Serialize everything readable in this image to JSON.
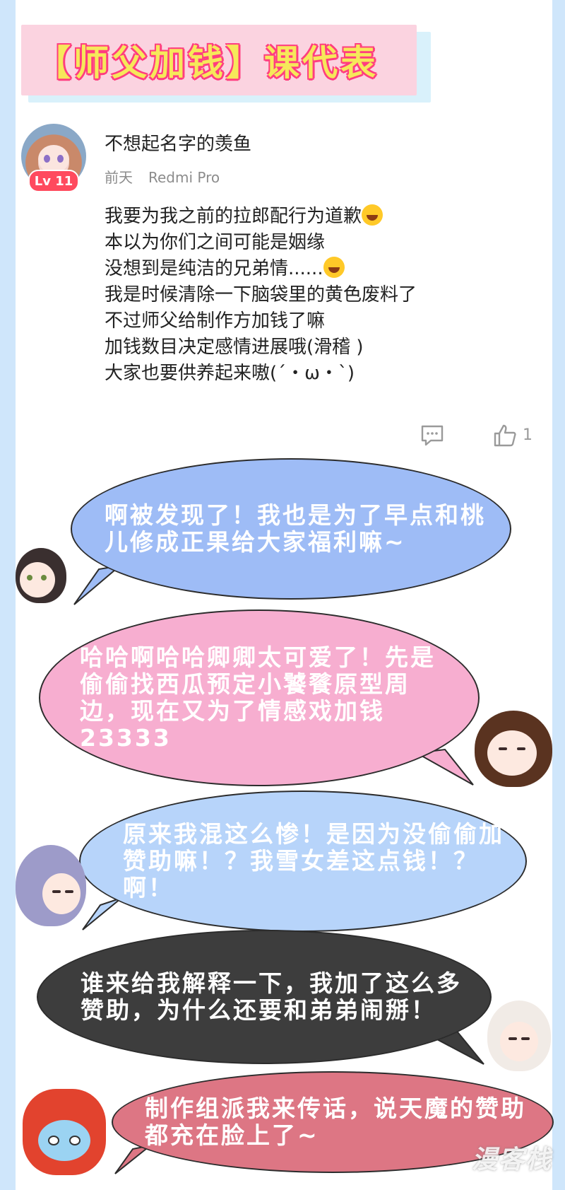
{
  "banner": {
    "title": "【师父加钱】课代表"
  },
  "comment": {
    "username": "不想起名字的羡鱼",
    "level_badge": "Lv 11",
    "time": "前天",
    "device": "Redmi Pro",
    "lines": [
      "我要为我之前的拉郎配行为道歉",
      "本以为你们之间可能是姻缘",
      "没想到是纯洁的兄弟情......",
      "我是时候清除一下脑袋里的黄色废料了",
      "不过师父给制作方加钱了嘛",
      "加钱数目决定感情进展哦(滑稽 )",
      "大家也要供养起来嗷(´・ω・`)"
    ],
    "like_count": "1"
  },
  "bubbles": [
    {
      "text": "啊被发现了！我也是为了早点和桃儿修成正果给大家福利嘛~",
      "color": "#9ebcf6"
    },
    {
      "text": "哈哈啊哈哈卿卿太可爱了！先是偷偷找西瓜预定小饕餮原型周边，现在又为了情感戏加钱23333",
      "color": "#f7aed0"
    },
    {
      "text": "原来我混这么惨！是因为没偷偷加赞助嘛！？我雪女差这点钱！？啊！",
      "color": "#b7d4fa"
    },
    {
      "text": "谁来给我解释一下，我加了这么多赞助，为什么还要和弟弟闹掰！",
      "color": "#3d3d3d"
    },
    {
      "text": "制作组派我来传话，说天魔的赞助都充在脸上了~",
      "color": "#dd7684"
    }
  ],
  "watermark": "漫客栈"
}
